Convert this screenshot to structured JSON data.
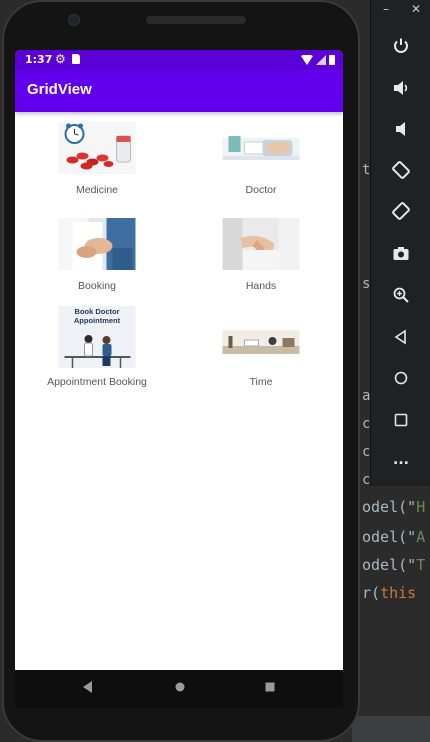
{
  "status_bar": {
    "time": "1:37"
  },
  "app_bar": {
    "title": "GridView"
  },
  "grid": {
    "items": [
      {
        "label": "Medicine",
        "image": "medicine-pills-image"
      },
      {
        "label": "Doctor",
        "image": "doctor-desk-image"
      },
      {
        "label": "Booking",
        "image": "doctor-handshake-image"
      },
      {
        "label": "Hands",
        "image": "hands-image"
      },
      {
        "label": "Appointment Booking",
        "image": "book-doctor-appointment-image",
        "image_text": "Book Doctor Appointment"
      },
      {
        "label": "Time",
        "image": "time-desk-image"
      }
    ]
  },
  "ide": {
    "lines": [
      {
        "code": "odel(\"",
        "str": "H"
      },
      {
        "code": "odel(\"",
        "str": "A"
      },
      {
        "code": "odel(\"",
        "str": "T"
      },
      {
        "code": "r(",
        "kw": "this"
      }
    ],
    "gutter": [
      "t",
      "s",
      "a",
      "c",
      "c",
      "c"
    ]
  },
  "emulator_toolbar": {
    "buttons": [
      "power-icon",
      "volume-up-icon",
      "volume-down-icon",
      "rotate-left-icon",
      "rotate-right-icon",
      "camera-icon",
      "zoom-icon",
      "back-icon",
      "home-icon",
      "overview-icon",
      "more-icon"
    ],
    "more_label": "..."
  },
  "colors": {
    "primary": "#6200ee",
    "status_bar": "#5b00d6",
    "ide_background": "#2b2b2b"
  }
}
